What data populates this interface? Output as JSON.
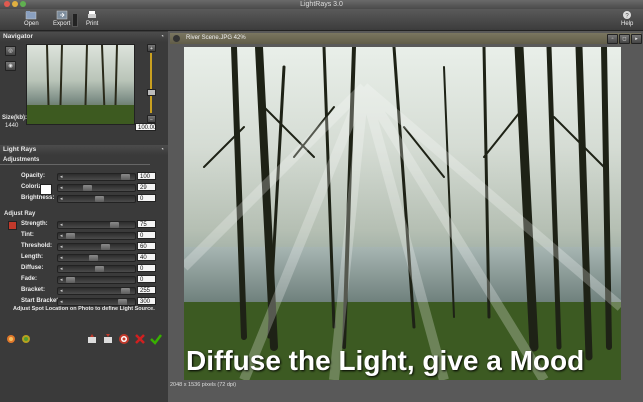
{
  "app": {
    "title": "LightRays 3.0"
  },
  "toolbar": {
    "open": "Open",
    "export": "Export",
    "print": "Print",
    "help": "Help"
  },
  "navigator": {
    "header": "Navigator",
    "size_label": "Size(kb):",
    "size_value": "1440",
    "zoom_value": "100.00"
  },
  "lightrays": {
    "header": "Light Rays",
    "tab": "Adjustments"
  },
  "adjustments": [
    {
      "label": "Opacity:",
      "value": "100",
      "pos": 0.95
    },
    {
      "label": "Colorize:",
      "value": "29",
      "pos": 0.29
    },
    {
      "label": "Brightness:",
      "value": "0",
      "pos": 0.5
    }
  ],
  "adjust_ray": {
    "header": "Adjust Ray",
    "rows": [
      {
        "label": "Strength:",
        "value": "75",
        "pos": 0.75
      },
      {
        "label": "Tint:",
        "value": "0",
        "pos": 0.0
      },
      {
        "label": "Threshold:",
        "value": "60",
        "pos": 0.6
      },
      {
        "label": "Length:",
        "value": "40",
        "pos": 0.4
      },
      {
        "label": "Diffuse:",
        "value": "0",
        "pos": 0.5
      },
      {
        "label": "Fade:",
        "value": "0",
        "pos": 0.0
      },
      {
        "label": "Bracket:",
        "value": "255",
        "pos": 0.95
      },
      {
        "label": "Start Bracket:",
        "value": "300",
        "pos": 0.9
      }
    ],
    "hint": "Adjust Spot Location on Photo to define Light Source."
  },
  "document": {
    "title": "River Scene.JPG 42%",
    "status": "2048 x 1536 pixels (72 dpi)"
  },
  "overlay_text": "Diffuse the Light, give a Mood",
  "colors": {
    "accent_red": "#c0392b",
    "check_green": "#38b000",
    "title_bar": "#6e6a54"
  }
}
